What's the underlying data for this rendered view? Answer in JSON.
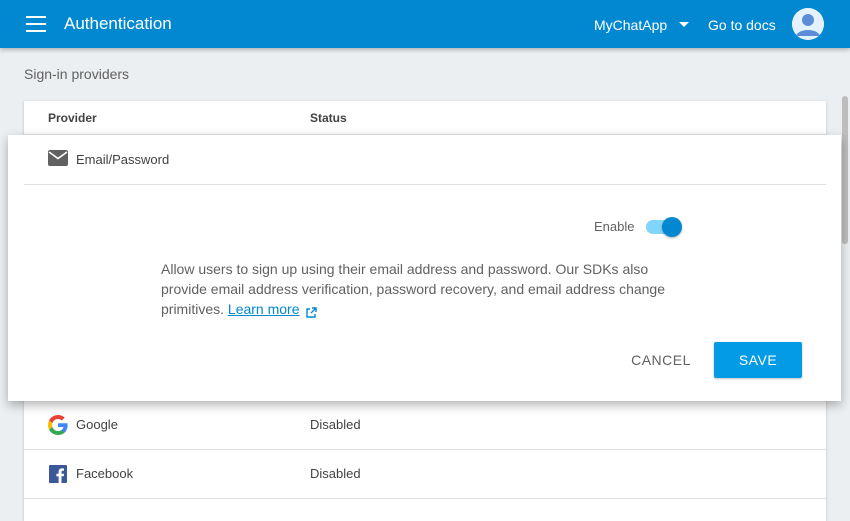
{
  "header": {
    "title": "Authentication",
    "project": "MyChatApp",
    "docs_link": "Go to docs"
  },
  "section": {
    "title": "Sign-in providers"
  },
  "table": {
    "columns": [
      "Provider",
      "Status"
    ],
    "rows": [
      {
        "name": "Google",
        "status": "Disabled",
        "icon": "google-icon"
      },
      {
        "name": "Facebook",
        "status": "Disabled",
        "icon": "facebook-icon"
      }
    ]
  },
  "expanded": {
    "provider": "Email/Password",
    "icon": "mail-icon",
    "enable_label": "Enable",
    "enabled": true,
    "description": "Allow users to sign up using their email address and password. Our SDKs also provide email address verification, password recovery, and email address change primitives.",
    "learn_more": "Learn more",
    "cancel_label": "CANCEL",
    "save_label": "SAVE"
  },
  "colors": {
    "header": "#0288d1",
    "accent": "#039be5",
    "background": "#eceff1"
  }
}
